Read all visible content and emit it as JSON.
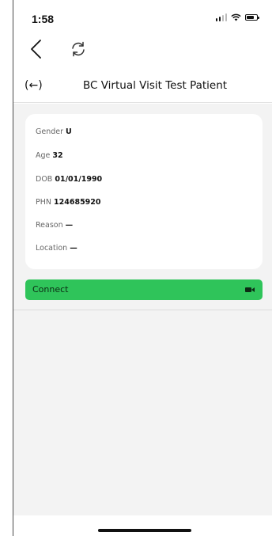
{
  "status_bar": {
    "time": "1:58"
  },
  "header": {
    "back_label": "(←)",
    "title": "BC Virtual Visit Test Patient"
  },
  "patient": {
    "gender_label": "Gender",
    "gender_value": "U",
    "age_label": "Age",
    "age_value": "32",
    "dob_label": "DOB",
    "dob_value": "01/01/1990",
    "phn_label": "PHN",
    "phn_value": "124685920",
    "reason_label": "Reason",
    "reason_value": "—",
    "location_label": "Location",
    "location_value": "—"
  },
  "connect": {
    "label": "Connect",
    "icon": "video-camera-icon"
  },
  "colors": {
    "accent": "#2fc45a",
    "background": "#f3f3f3",
    "card": "#ffffff"
  }
}
